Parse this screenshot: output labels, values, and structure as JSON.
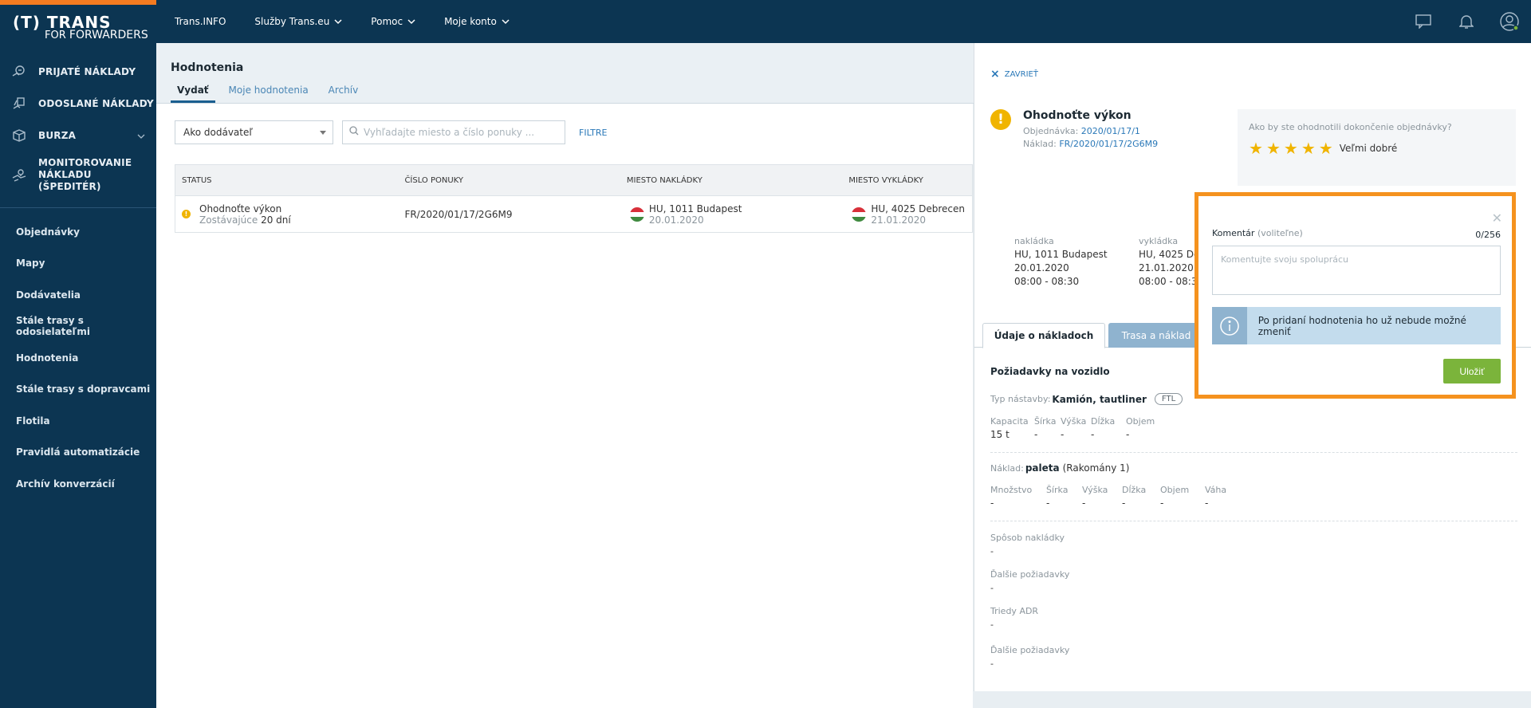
{
  "logo": {
    "main": "(T) TRANS",
    "sub_prefix": "FOR",
    "sub_main": "FORWARDERS"
  },
  "sidebar": {
    "primary": [
      {
        "label": "PRIJATÉ NÁKLADY",
        "icon": "received-loads-icon"
      },
      {
        "label": "ODOSLANÉ NÁKLADY",
        "icon": "sent-loads-icon"
      },
      {
        "label": "BURZA",
        "icon": "exchange-box-icon"
      },
      {
        "label": "MONITOROVANIE NÁKLADU (ŠPEDITÉR)",
        "icon": "monitoring-icon"
      }
    ],
    "secondary": [
      "Objednávky",
      "Mapy",
      "Dodávatelia",
      "Stále trasy s odosielateľmi",
      "Hodnotenia",
      "Stále trasy s dopravcami",
      "Flotila",
      "Pravidlá automatizácie",
      "Archív konverzácií"
    ]
  },
  "topbar": {
    "items": [
      "Trans.INFO",
      "Služby Trans.eu",
      "Pomoc",
      "Moje konto"
    ]
  },
  "page": {
    "title": "Hodnotenia",
    "tabs": [
      "Vydať",
      "Moje hodnotenia",
      "Archív"
    ]
  },
  "filters": {
    "select_value": "Ako dodávateľ",
    "search_placeholder": "Vyhľadajte miesto a číslo ponuky ...",
    "filter_label": "FILTRE"
  },
  "table": {
    "headers": [
      "STATUS",
      "ČÍSLO PONUKY",
      "MIESTO NAKLÁDKY",
      "MIESTO VYKLÁDKY"
    ],
    "rows": [
      {
        "status": "Ohodnoťte výkon",
        "remaining_label": "Zostávajúce",
        "remaining_value": "20 dní",
        "offer": "FR/2020/01/17/2G6M9",
        "loading_place": "HU, 1011 Budapest",
        "loading_date": "20.01.2020",
        "unloading_place": "HU, 4025 Debrecen",
        "unloading_date": "21.01.2020"
      }
    ]
  },
  "panel": {
    "close_label": "ZAVRIEŤ",
    "title": "Ohodnoťte výkon",
    "order_label": "Objednávka:",
    "order_value": "2020/01/17/1",
    "load_label": "Náklad:",
    "load_value": "FR/2020/01/17/2G6M9",
    "rating_question": "Ako by ste ohodnotili dokončenie objednávky?",
    "rating_stars": 5,
    "rating_label": "Veľmi dobré",
    "loading": {
      "label": "nakládka",
      "place": "HU, 1011 Budapest",
      "date": "20.01.2020",
      "time": "08:00 - 08:30"
    },
    "unloading": {
      "label": "vykládka",
      "place": "HU, 4025 De",
      "date": "21.01.2020",
      "time": "08:00 - 08:3"
    },
    "tabs": [
      "Údaje o nákladoch",
      "Trasa a náklad"
    ],
    "vehicle_title": "Požiadavky na vozidlo",
    "body_type_label": "Typ nástavby:",
    "body_type_value": "Kamión, tautliner",
    "ftl": "FTL",
    "vehicle_specs": [
      {
        "k": "Kapacita",
        "v": "15 t"
      },
      {
        "k": "Šírka",
        "v": "-"
      },
      {
        "k": "Výška",
        "v": "-"
      },
      {
        "k": "Dĺžka",
        "v": "-"
      },
      {
        "k": "Objem",
        "v": "-"
      }
    ],
    "cargo_label": "Náklad:",
    "cargo_value": "paleta",
    "cargo_extra": "(Rakomány 1)",
    "cargo_specs": [
      {
        "k": "Množstvo",
        "v": "-"
      },
      {
        "k": "Šírka",
        "v": "-"
      },
      {
        "k": "Výška",
        "v": "-"
      },
      {
        "k": "Dĺžka",
        "v": "-"
      },
      {
        "k": "Objem",
        "v": "-"
      },
      {
        "k": "Váha",
        "v": "-"
      }
    ],
    "blocks": [
      {
        "k": "Spôsob nakládky",
        "v": "-"
      },
      {
        "k": "Ďalšie požiadavky",
        "v": "-"
      },
      {
        "k": "Triedy ADR",
        "v": "-"
      },
      {
        "k": "Ďalšie požiadavky",
        "v": "-"
      }
    ]
  },
  "popup": {
    "comment_label": "Komentár",
    "comment_optional": "(voliteľne)",
    "counter": "0/256",
    "placeholder": "Komentujte svoju spoluprácu",
    "info_text": "Po pridaní hodnotenia ho už nebude možné zmeniť",
    "save_label": "Uložiť"
  },
  "colors": {
    "navy": "#0c3552",
    "accent_orange": "#f5921e",
    "link_blue": "#2a78b8",
    "warning_yellow": "#f0b400",
    "save_green": "#7bb43b"
  }
}
